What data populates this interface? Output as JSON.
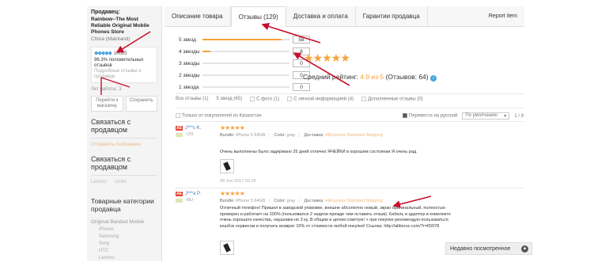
{
  "sidebar": {
    "seller_heading": "Продавец:",
    "store_name": "Rainbow--The Most Reliable Original Mobile Phones Store",
    "location": "China (Mainland)",
    "feedback_count": "10065",
    "positive_percent": "96.3%",
    "positive_label": "положительных отзывов",
    "detailed_link": "Подробные отзывы о продавце",
    "years_open": "Лет работы: 3",
    "goto_store_btn": "Перейти к магазину",
    "save_btn": "Сохранить",
    "contact_title": "Связаться с продавцом",
    "send_message": "Отправить сообщение",
    "contact_title2": "Связаться с продавцом",
    "online_a": "Lenovo",
    "online_b": "Umilo",
    "categories_title": "Товарные категории продавца",
    "category_parent": "Original Banded Mobile",
    "category_items": [
      "iPhone",
      "Samsung",
      "Sony",
      "HTC",
      "Lenovo"
    ]
  },
  "tabs": {
    "description": "Описание товара",
    "reviews": "Отзывы (129)",
    "shipping": "Доставка и оплата",
    "guarantee": "Гарантии продавца",
    "report": "Report item"
  },
  "ratings": {
    "rows": [
      {
        "label": "5 звезд",
        "count": "58",
        "fraction": 0.906
      },
      {
        "label": "4 звезды",
        "count": "6",
        "fraction": 0.094
      },
      {
        "label": "3 звезды",
        "count": "0",
        "fraction": 0
      },
      {
        "label": "2 звезды",
        "count": "0",
        "fraction": 0
      },
      {
        "label": "1 звезда",
        "count": "0",
        "fraction": 0
      }
    ],
    "stars": "★★★★★",
    "avg_label": "Средний рейтинг:",
    "avg_value": "4.9 из 5",
    "total": "(Отзывов: 64)"
  },
  "filters": {
    "all": "Все отзывы (1)",
    "five_star": "5 звезд (65)",
    "with_photo": "С фото (1)",
    "with_personal": "С личной информацией (4)",
    "additional": "Дополненные отзывы (0)",
    "from_kazakhstan": "Только от покупателей из Казахстан",
    "translate": "Перевести на русский",
    "sort": "По умолчанию",
    "page": "1 / 9"
  },
  "reviews": [
    {
      "name": "J***s K.",
      "country": "CN",
      "stars": "★★★★★",
      "bundle_label": "Bundle:",
      "bundle": "iPhone 5 64GB",
      "color_label": "Color:",
      "color": "gray",
      "delivery_label": "Доставка:",
      "delivery": "AliExpress Standard Shipping",
      "text": "Очень выполнены было задержано 25 дней отлично ЯЧЕЙКИ в хорошем состоянии Я очень рад.",
      "date": "28 Jan 2017 03:24"
    },
    {
      "name": "J***a P.",
      "country": "RU",
      "stars": "★★★★★",
      "bundle_label": "Bundle:",
      "bundle": "iPhone 5 64GB",
      "color_label": "Color:",
      "color": "gray",
      "delivery_label": "Доставка:",
      "delivery": "AliExpress Standard Shipping",
      "text": "Отличный телефон! Пришел в заводской упаковке, внешне абсолютно новый, экран оригинальный, полностью проверен и работает на 100% (пользовался 2 недели прежде чем оставить отзыв). Кабель и адаптер в комплекте очень хорошего качества, наушники не 3 ку. В общем и целом советую! + при покупке рекомендую пользоваться кешбэк сервисом и получать возврат 10% от стоимости любой покупки! Ссылка: http://aliboruc.com/?r=65978",
      "date": ""
    }
  ],
  "recent": {
    "label": "Недавно посмотренное",
    "icon": "up-arrow-icon"
  },
  "colors": {
    "accent": "#f7a23b",
    "link": "#4a78c2",
    "arrow": "#c8102e"
  }
}
